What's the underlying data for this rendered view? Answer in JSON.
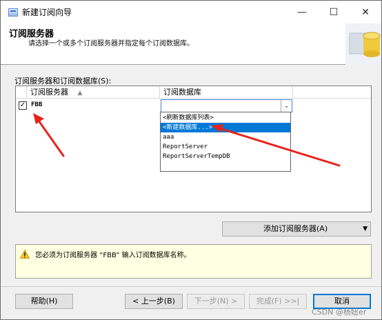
{
  "window": {
    "title": "新建订阅向导",
    "minimize": "—",
    "maximize": "☐",
    "close": "✕"
  },
  "header": {
    "title": "订阅服务器",
    "subtitle": "请选择一个或多个订阅服务器并指定每个订阅数据库。"
  },
  "section_label": "订阅服务器和订阅数据库(S):",
  "grid": {
    "col_server": "订阅服务器",
    "col_db": "订阅数据库",
    "rows": [
      {
        "server": "FBB",
        "checked": "✓"
      }
    ]
  },
  "dropdown": {
    "items": [
      "<刷新数据库列表>",
      "<新建数据库...>",
      "aaa",
      "ReportServer",
      "ReportServerTempDB"
    ],
    "selected_index": 1
  },
  "add_button": {
    "label": "添加订阅服务器(A)",
    "arrow": "▼"
  },
  "message": "您必须为订阅服务器 “FBB” 输入订阅数据库名称。",
  "buttons": {
    "help": "帮助(H)",
    "back": "< 上一步(B)",
    "next": "下一步(N) >",
    "finish": "完成(F) >>|",
    "cancel": "取消"
  },
  "watermark": "CSDN @杨妞er",
  "colors": {
    "selection": "#0078d7",
    "arrow": "#e8221b",
    "info_bg": "#ffffe1"
  }
}
